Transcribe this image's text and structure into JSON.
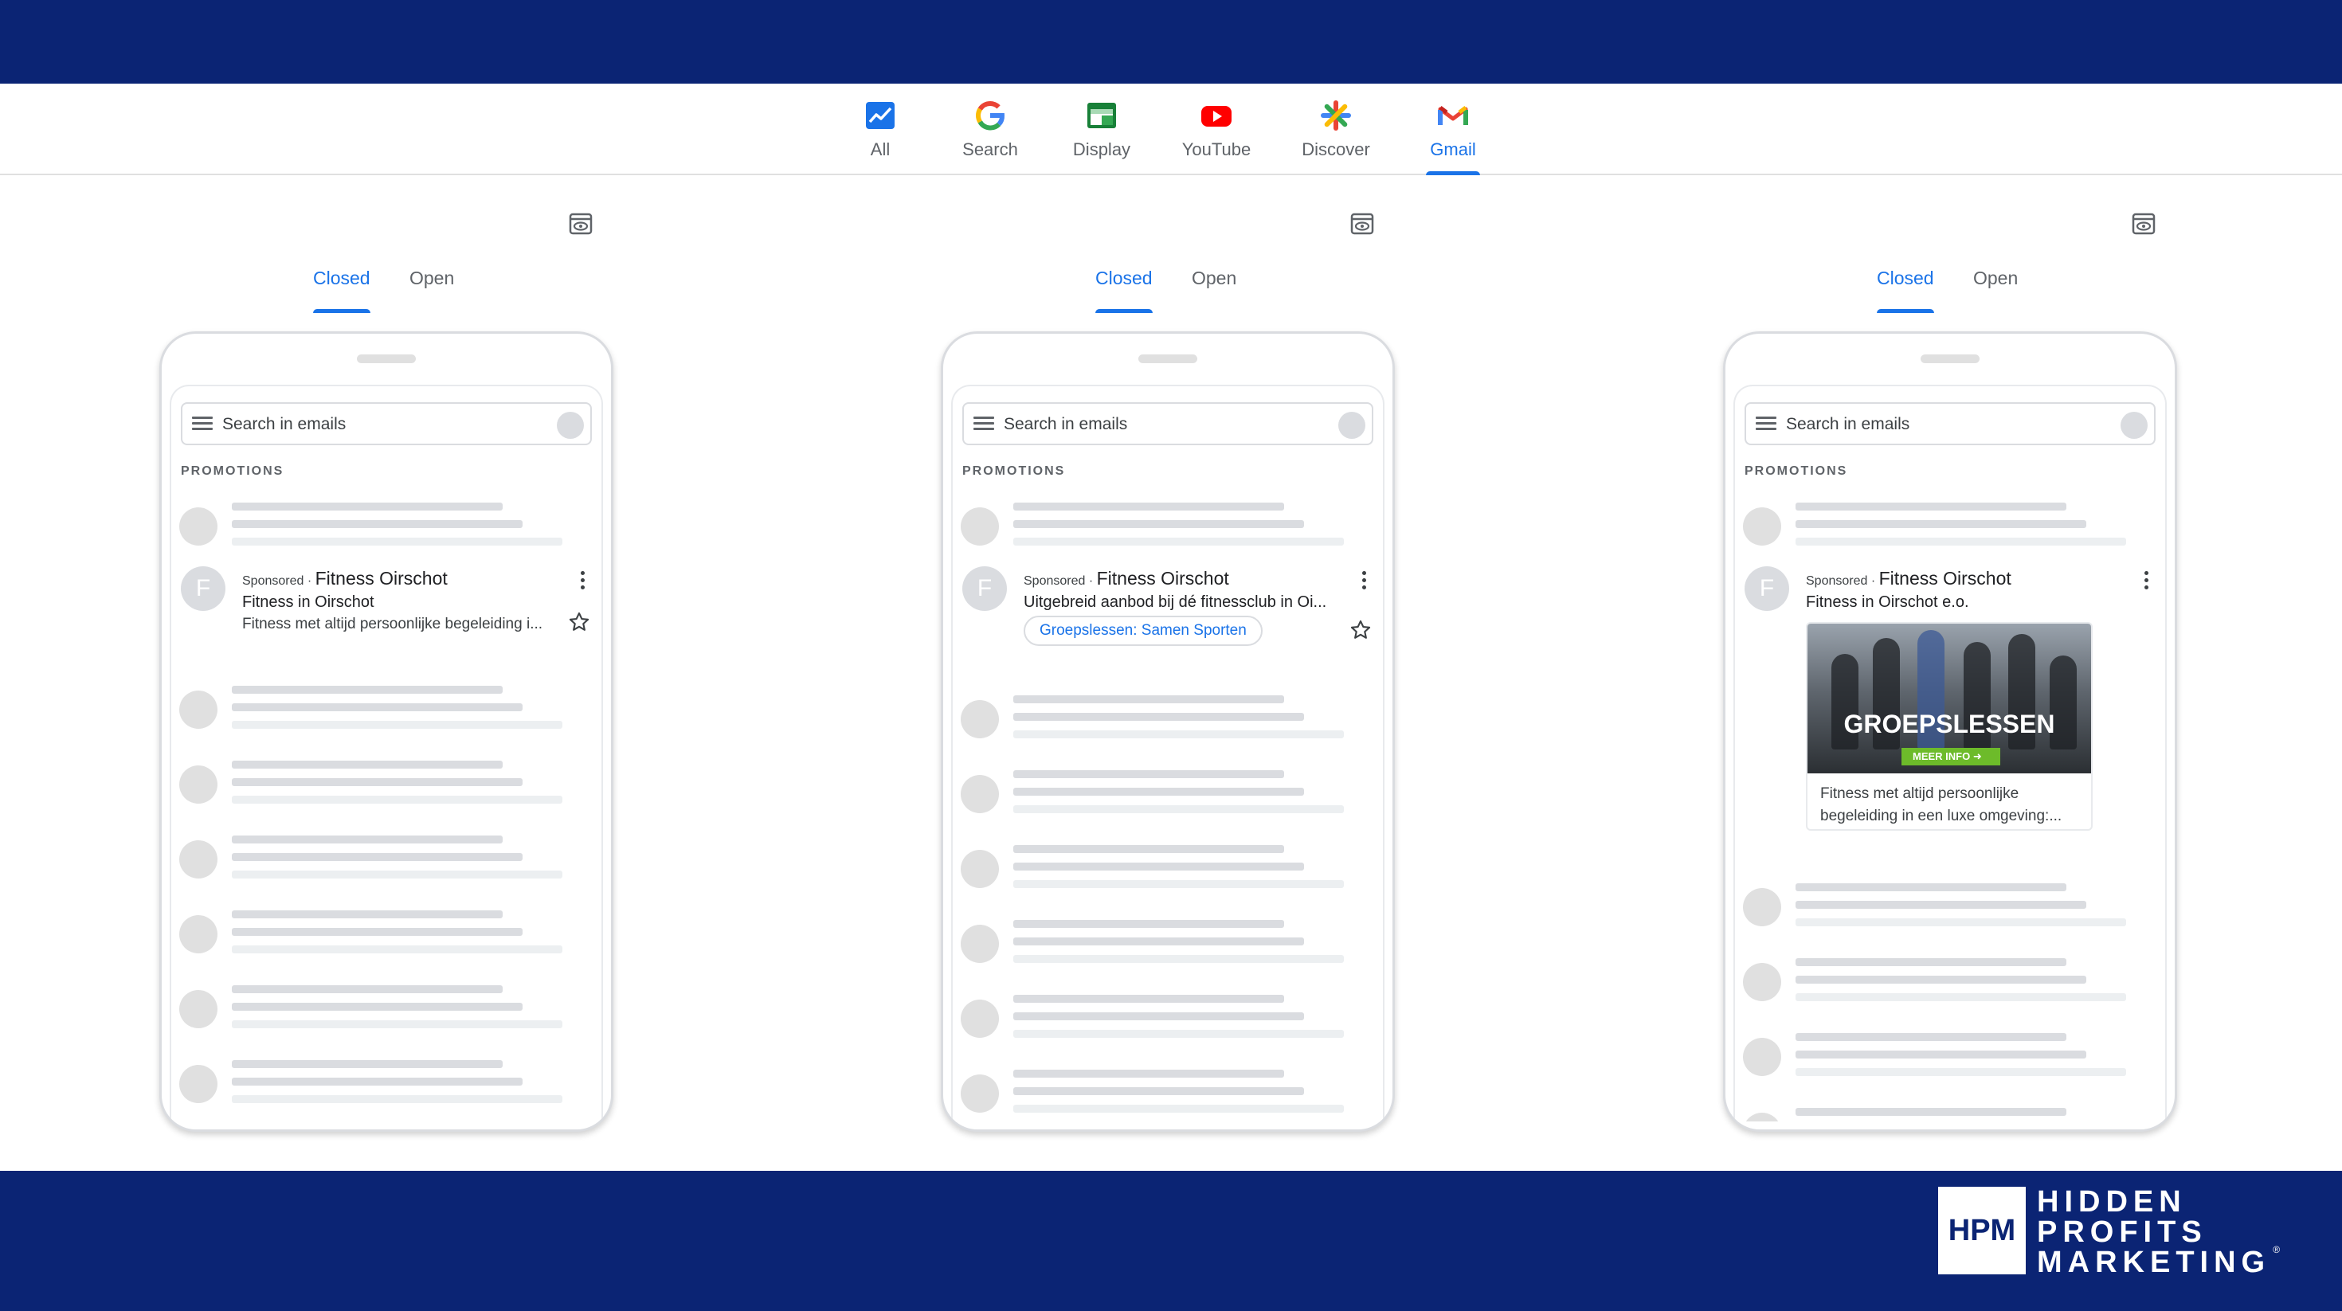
{
  "channels": [
    {
      "label": "All",
      "icon": "chart-icon"
    },
    {
      "label": "Search",
      "icon": "google-g-icon"
    },
    {
      "label": "Display",
      "icon": "display-ad-icon"
    },
    {
      "label": "YouTube",
      "icon": "youtube-icon"
    },
    {
      "label": "Discover",
      "icon": "discover-icon"
    },
    {
      "label": "Gmail",
      "icon": "gmail-icon",
      "active": true
    }
  ],
  "state_tabs": {
    "closed": "Closed",
    "open": "Open",
    "active": "closed"
  },
  "inbox": {
    "search_placeholder": "Search in emails",
    "section": "PROMOTIONS"
  },
  "ads": [
    {
      "avatar": "F",
      "sponsored": "Sponsored",
      "separator": " · ",
      "advertiser": "Fitness Oirschot",
      "headline": "Fitness in Oirschot",
      "description": "Fitness met altijd persoonlijke begeleiding i..."
    },
    {
      "avatar": "F",
      "sponsored": "Sponsored",
      "separator": " · ",
      "advertiser": "Fitness Oirschot",
      "headline": "Uitgebreid aanbod bij dé fitnessclub in Oi...",
      "chip": "Groepslessen: Samen Sporten"
    },
    {
      "avatar": "F",
      "sponsored": "Sponsored",
      "separator": " · ",
      "advertiser": "Fitness Oirschot",
      "headline": "Fitness in Oirschot e.o.",
      "image_title": "GROEPSLESSEN",
      "image_cta": "MEER INFO",
      "card_description": "Fitness met altijd persoonlijke begeleiding in een luxe omgeving:..."
    }
  ],
  "brand": {
    "box": "HPM",
    "line1": "HIDDEN",
    "line2": "PROFITS",
    "line3": "MARKETING",
    "reg": "®"
  },
  "colors": {
    "band": "#0b2474",
    "accent": "#1a73e8",
    "skeleton": "#dadce0"
  }
}
